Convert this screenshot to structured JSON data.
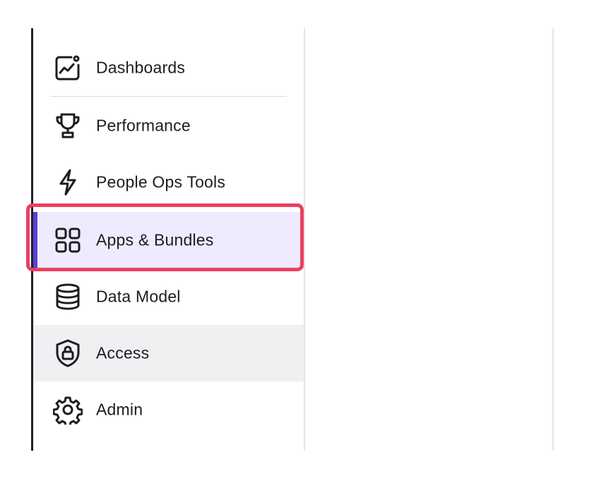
{
  "sidebar": {
    "items": [
      {
        "label": "Dashboards",
        "icon": "dashboard-chart-icon",
        "active": false
      },
      {
        "label": "Performance",
        "icon": "trophy-icon",
        "active": false
      },
      {
        "label": "People Ops Tools",
        "icon": "lightning-icon",
        "active": false
      },
      {
        "label": "Apps & Bundles",
        "icon": "grid-icon",
        "active": true
      },
      {
        "label": "Data Model",
        "icon": "database-icon",
        "active": false
      },
      {
        "label": "Access",
        "icon": "shield-lock-icon",
        "active": false,
        "hovered": true
      },
      {
        "label": "Admin",
        "icon": "gear-icon",
        "active": false
      }
    ]
  },
  "colors": {
    "active_bg": "#efeafd",
    "active_bar": "#5b3fd6",
    "hover_bg": "#eff0f2",
    "highlight_border": "#e8415f",
    "text": "#1c1c21"
  }
}
